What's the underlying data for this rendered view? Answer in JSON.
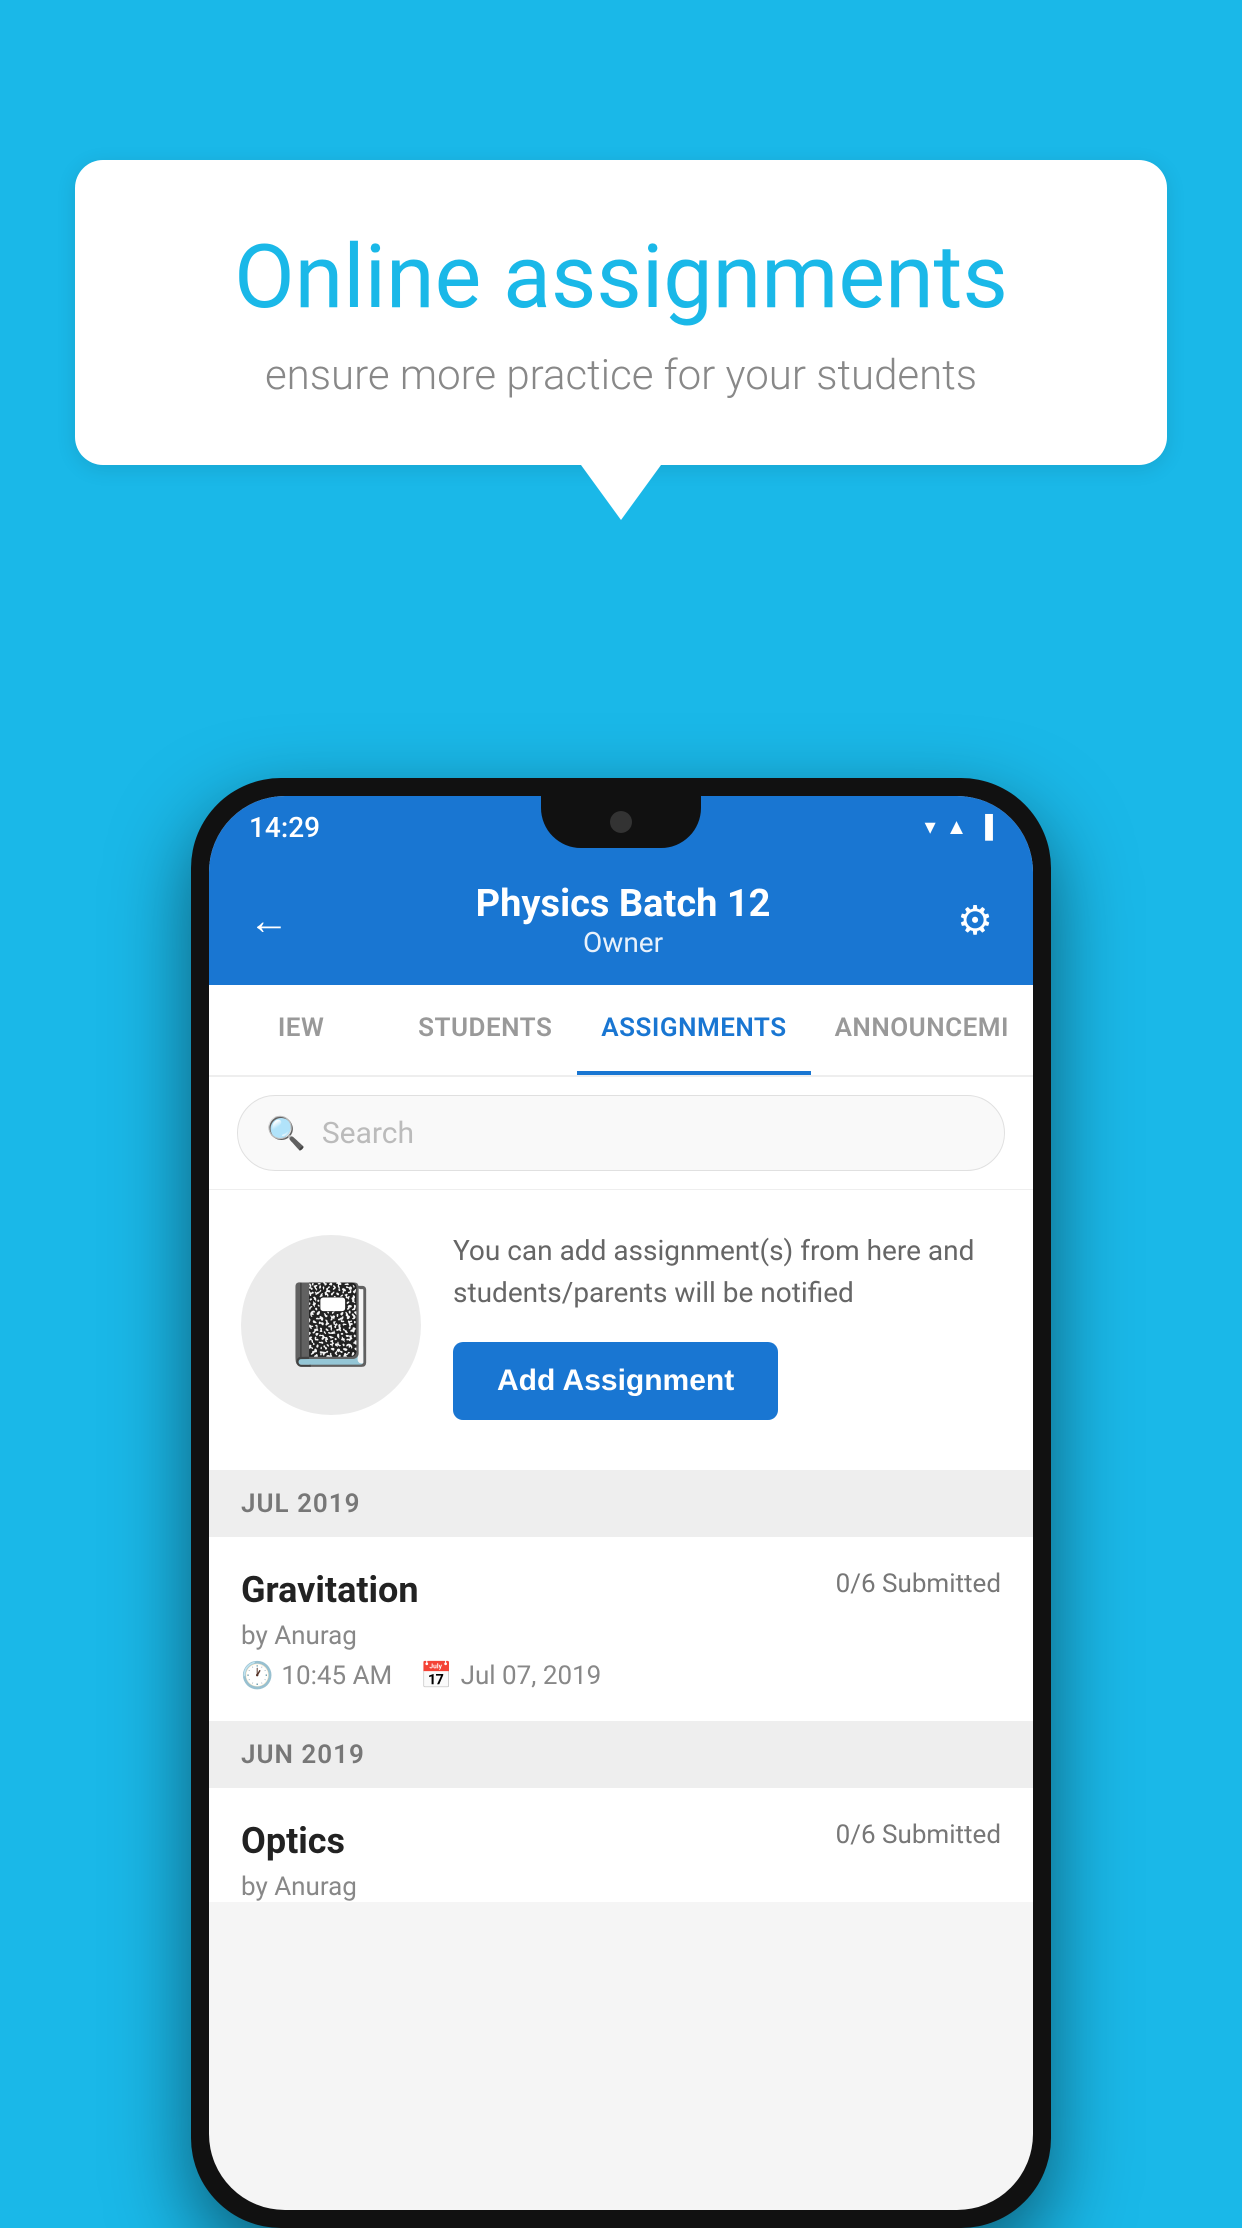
{
  "background_color": "#1ab8e8",
  "speech_bubble": {
    "title": "Online assignments",
    "subtitle": "ensure more practice for your students"
  },
  "phone": {
    "status_bar": {
      "time": "14:29",
      "icons": [
        "▼",
        "▲",
        "▐"
      ]
    },
    "header": {
      "title": "Physics Batch 12",
      "subtitle": "Owner",
      "back_label": "←",
      "gear_label": "⚙"
    },
    "tabs": [
      {
        "label": "IEW",
        "active": false
      },
      {
        "label": "STUDENTS",
        "active": false
      },
      {
        "label": "ASSIGNMENTS",
        "active": true
      },
      {
        "label": "ANNOUNCEMI",
        "active": false
      }
    ],
    "search": {
      "placeholder": "Search"
    },
    "add_assignment_card": {
      "hint_text": "You can add assignment(s) from here and students/parents will be notified",
      "button_label": "Add Assignment"
    },
    "sections": [
      {
        "label": "JUL 2019",
        "assignments": [
          {
            "name": "Gravitation",
            "submitted": "0/6 Submitted",
            "author": "by Anurag",
            "time": "10:45 AM",
            "date": "Jul 07, 2019"
          }
        ]
      },
      {
        "label": "JUN 2019",
        "assignments": [
          {
            "name": "Optics",
            "submitted": "0/6 Submitted",
            "author": "by Anurag",
            "time": "",
            "date": ""
          }
        ]
      }
    ]
  }
}
